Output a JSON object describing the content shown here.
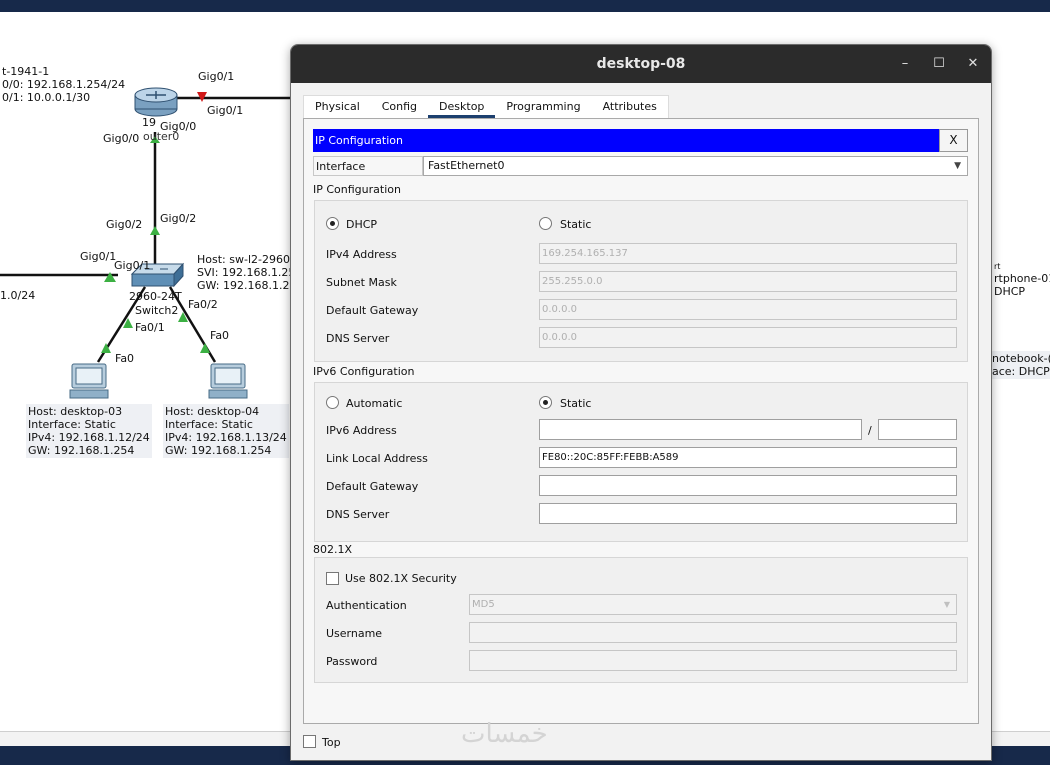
{
  "dialog": {
    "title": "desktop-08",
    "minimize": "–",
    "maximize": "☐",
    "close": "✕",
    "tabs": [
      "Physical",
      "Config",
      "Desktop",
      "Programming",
      "Attributes"
    ],
    "active_tab": "Desktop"
  },
  "ipconfig": {
    "header": "IP Configuration",
    "close_label": "X",
    "interface_label": "Interface",
    "interface_value": "FastEthernet0",
    "ipv4_section": "IP Configuration",
    "dhcp_label": "DHCP",
    "static_label": "Static",
    "ipv4_mode": "DHCP",
    "ipv4_address_label": "IPv4 Address",
    "ipv4_address": "169.254.165.137",
    "subnet_mask_label": "Subnet Mask",
    "subnet_mask": "255.255.0.0",
    "gateway_label": "Default Gateway",
    "gateway": "0.0.0.0",
    "dns_label": "DNS Server",
    "dns": "0.0.0.0",
    "ipv6_section": "IPv6 Configuration",
    "automatic_label": "Automatic",
    "ipv6_static_label": "Static",
    "ipv6_mode": "Static",
    "ipv6_address_label": "IPv6 Address",
    "ipv6_address": "",
    "ipv6_prefix_sep": "/",
    "ipv6_prefix": "",
    "link_local_label": "Link Local Address",
    "link_local": "FE80::20C:85FF:FEBB:A589",
    "ipv6_gateway_label": "Default Gateway",
    "ipv6_gateway": "",
    "ipv6_dns_label": "DNS Server",
    "ipv6_dns": "",
    "dot1x_section": "802.1X",
    "use_dot1x_label": "Use 802.1X Security",
    "use_dot1x": false,
    "auth_label": "Authentication",
    "auth_value": "MD5",
    "username_label": "Username",
    "username": "",
    "password_label": "Password",
    "password": ""
  },
  "footer": {
    "top_label": "Top",
    "watermark": "خمسات"
  },
  "topology": {
    "router_info": [
      "t-1941-1",
      "0/0: 192.168.1.254/24",
      "0/1: 10.0.0.1/30"
    ],
    "router_name_partial": "19",
    "router_name_overlap": "outer0",
    "labels": {
      "gig01_top": "Gig0/1",
      "gig01_right": "Gig0/1",
      "gig00_a": "Gig0/0",
      "gig00_b": "Gig0/0",
      "gig02_left": "Gig0/2",
      "gig02_right": "Gig0/2",
      "gig01_sw_left": "Gig0/1",
      "gig01_sw": "Gig0/1",
      "switch_model": "2960-24T",
      "switch_name": "Switch2",
      "fa01": "Fa0/1",
      "fa02": "Fa0/2",
      "fa0_left": "Fa0",
      "fa0_right": "Fa0",
      "net_left": "1.0/24"
    },
    "switch_info": [
      "Host: sw-l2-2960-",
      "SVI: 192.168.1.25",
      "GW: 192.168.1.25"
    ],
    "desktop03": [
      "Host: desktop-03",
      "Interface: Static",
      "IPv4: 192.168.1.12/24",
      "GW: 192.168.1.254"
    ],
    "desktop04": [
      "Host: desktop-04",
      "Interface: Static",
      "IPv4: 192.168.1.13/24",
      "GW: 192.168.1.254"
    ],
    "smartphone": [
      "rt",
      "rtphone-01",
      "DHCP"
    ],
    "notebook": [
      "notebook-(",
      "ace: DHCP"
    ]
  }
}
